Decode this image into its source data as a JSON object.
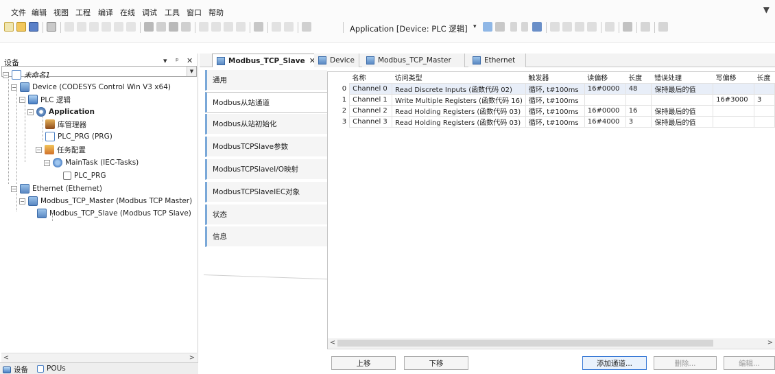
{
  "menubar": {
    "items": [
      "文件",
      "编辑",
      "视图",
      "工程",
      "编译",
      "在线",
      "调试",
      "工具",
      "窗口",
      "帮助"
    ]
  },
  "toolbar": {
    "app_selector": "Application [Device: PLC 逻辑]"
  },
  "devices_panel": {
    "title": "设备",
    "pin_label": "▾ 📌 ✕",
    "tree": [
      {
        "label": "未命名1",
        "italic": true
      },
      {
        "label": "Device (CODESYS Control Win V3 x64)"
      },
      {
        "label": "PLC 逻辑"
      },
      {
        "label": "Application",
        "bold": true
      },
      {
        "label": "库管理器"
      },
      {
        "label": "PLC_PRG (PRG)"
      },
      {
        "label": "任务配置"
      },
      {
        "label": "MainTask (IEC-Tasks)"
      },
      {
        "label": "PLC_PRG"
      },
      {
        "label": "Ethernet (Ethernet)"
      },
      {
        "label": "Modbus_TCP_Master (Modbus TCP Master)"
      },
      {
        "label": "Modbus_TCP_Slave (Modbus TCP Slave)"
      }
    ],
    "bottom_tabs": [
      "设备",
      "POUs"
    ]
  },
  "editor": {
    "doc_tabs": [
      {
        "label": "Modbus_TCP_Slave",
        "active": true,
        "close": "✕"
      },
      {
        "label": "Device"
      },
      {
        "label": "Modbus_TCP_Master"
      },
      {
        "label": "Ethernet"
      }
    ],
    "side_tabs": [
      "通用",
      "Modbus从站通道",
      "Modbus从站初始化",
      "ModbusTCPSlave参数",
      "ModbusTCPSlaveI/O映射",
      "ModbusTCPSlaveIEC对象",
      "状态",
      "信息"
    ],
    "active_side_tab": 1,
    "table": {
      "headers": [
        "",
        "名称",
        "访问类型",
        "触发器",
        "读偏移",
        "长度",
        "错误处理",
        "写偏移",
        "长度"
      ],
      "rows": [
        [
          "0",
          "Channel 0",
          "Read Discrete Inputs (函数代码 02)",
          "循环, t#100ms",
          "16#0000",
          "48",
          "保持最后的值",
          "",
          ""
        ],
        [
          "1",
          "Channel 1",
          "Write Multiple Registers (函数代码 16)",
          "循环, t#100ms",
          "",
          "",
          "",
          "16#3000",
          "3"
        ],
        [
          "2",
          "Channel 2",
          "Read Holding Registers (函数代码 03)",
          "循环, t#100ms",
          "16#0000",
          "16",
          "保持最后的值",
          "",
          ""
        ],
        [
          "3",
          "Channel 3",
          "Read Holding Registers (函数代码 03)",
          "循环, t#100ms",
          "16#4000",
          "3",
          "保持最后的值",
          "",
          ""
        ]
      ]
    },
    "buttons": {
      "move_up": "上移",
      "move_down": "下移",
      "add_channel": "添加通道...",
      "delete": "删除...",
      "edit": "编辑..."
    }
  }
}
